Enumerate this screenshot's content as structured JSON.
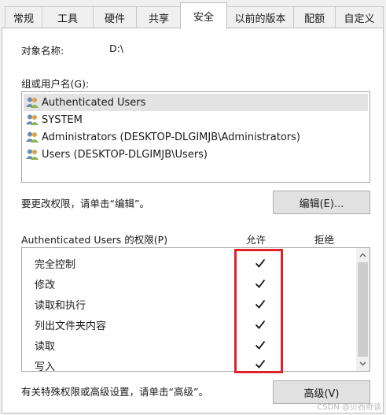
{
  "tabs": [
    {
      "label": "常规"
    },
    {
      "label": "工具"
    },
    {
      "label": "硬件"
    },
    {
      "label": "共享"
    },
    {
      "label": "安全"
    },
    {
      "label": "以前的版本"
    },
    {
      "label": "配额"
    },
    {
      "label": "自定义"
    }
  ],
  "active_tab": "安全",
  "object": {
    "label": "对象名称:",
    "value": "D:\\"
  },
  "groups": {
    "label": "组或用户名(G):",
    "items": [
      {
        "label": "Authenticated Users",
        "selected": true
      },
      {
        "label": "SYSTEM"
      },
      {
        "label": "Administrators (DESKTOP-DLGIMJB\\Administrators)"
      },
      {
        "label": "Users (DESKTOP-DLGIMJB\\Users)"
      }
    ]
  },
  "change_hint": "要更改权限，请单击“编辑”。",
  "edit_button": "编辑(E)...",
  "permissions": {
    "title": "Authenticated Users 的权限(P)",
    "allow_header": "允许",
    "deny_header": "拒绝",
    "rows": [
      {
        "label": "完全控制",
        "allow": true,
        "deny": false
      },
      {
        "label": "修改",
        "allow": true,
        "deny": false
      },
      {
        "label": "读取和执行",
        "allow": true,
        "deny": false
      },
      {
        "label": "列出文件夹内容",
        "allow": true,
        "deny": false
      },
      {
        "label": "读取",
        "allow": true,
        "deny": false
      },
      {
        "label": "写入",
        "allow": true,
        "deny": false
      }
    ]
  },
  "advanced_hint": "有关特殊权限或高级设置，请单击“高级”。",
  "advanced_button": "高级(V)",
  "watermark": "CSDN @贝西奇谈",
  "colors": {
    "highlight_box": "#e0202b",
    "selected_row": "#e3e3e3"
  }
}
